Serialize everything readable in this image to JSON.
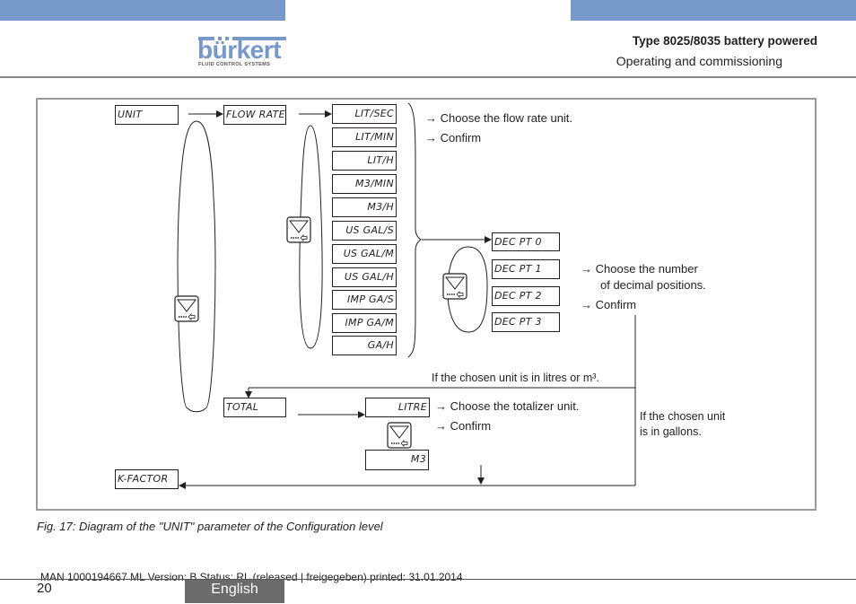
{
  "header": {
    "brand_name": "bürkert",
    "brand_tagline": "FLUID CONTROL SYSTEMS",
    "title": "Type 8025/8035 battery powered",
    "subtitle": "Operating and commissioning",
    "accent_color": "#7799c9"
  },
  "diagram": {
    "unit_label": "UNIT",
    "flow_rate_label": "FLOW RATE",
    "flow_rate_units": [
      "LIT/SEC",
      "LIT/MIN",
      "LIT/H",
      "M3/MIN",
      "M3/H",
      "US GAL/S",
      "US GAL/M",
      "US GAL/H",
      "IMP GA/S",
      "IMP GA/M",
      "GA/H"
    ],
    "flow_rate_notes": [
      "→ Choose the flow rate unit.",
      "→ Confirm"
    ],
    "decimal_options": [
      "DEC PT 0",
      "DEC PT 1",
      "DEC PT 2",
      "DEC PT 3"
    ],
    "decimal_notes": [
      "→ Choose the number",
      "of decimal positions.",
      "→ Confirm"
    ],
    "litres_condition": "If the chosen unit is in litres or m³.",
    "gallons_condition_line1": "If the chosen unit",
    "gallons_condition_line2": "is in gallons.",
    "total_label": "TOTAL",
    "totalizer_units": [
      "LITRE",
      "M3"
    ],
    "totalizer_notes": [
      "→ Choose the totalizer unit.",
      "→ Confirm"
    ],
    "k_factor_label": "K-FACTOR",
    "scroll_key_icon": "down-arrow-key-icon"
  },
  "caption": "Fig. 17:   Diagram of the \"UNIT\" parameter of the Configuration level",
  "footer": {
    "meta": "MAN  1000194667  ML  Version: B Status: RL (released | freigegeben)  printed: 31.01.2014",
    "page_number": "20",
    "language": "English"
  }
}
